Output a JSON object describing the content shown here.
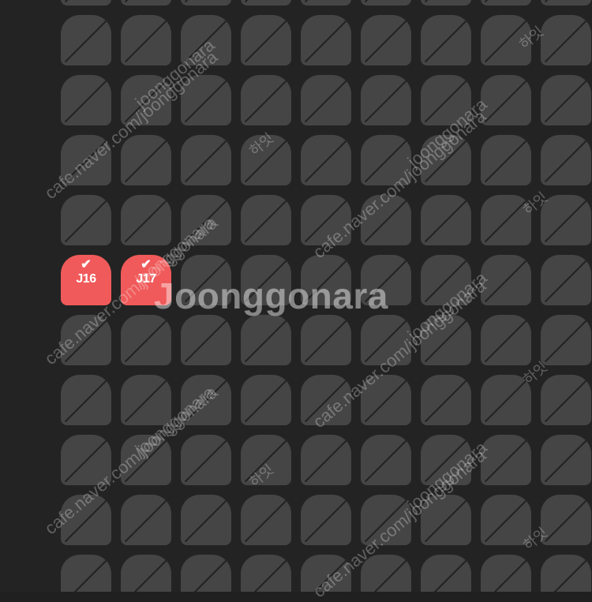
{
  "seat_map": {
    "status_colors": {
      "unavailable": "#454545",
      "selected": "#f05a5a",
      "background": "#232323"
    },
    "selected_seats": [
      {
        "label": "J16",
        "check_icon": "check-icon",
        "check_glyph": "✔"
      },
      {
        "label": "J17",
        "check_icon": "check-icon",
        "check_glyph": "✔"
      }
    ]
  },
  "watermark": {
    "center_text": "Joonggonara",
    "url_text": "cafe.naver.com/joonggonara",
    "brand_text": "joonggonara",
    "small_text": "하잇"
  }
}
